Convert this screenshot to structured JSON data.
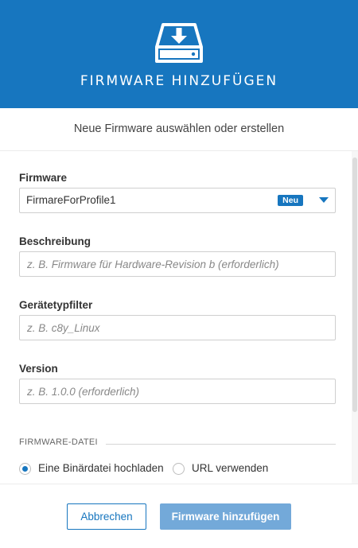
{
  "header": {
    "title": "FIRMWARE HINZUFÜGEN",
    "icon": "hard-drive-download-icon"
  },
  "subtitle": "Neue Firmware auswählen oder erstellen",
  "form": {
    "firmware": {
      "label": "Firmware",
      "value": "FirmareForProfile1",
      "badge": "Neu"
    },
    "description": {
      "label": "Beschreibung",
      "placeholder": "z. B. Firmware für Hardware-Revision b (erforderlich)"
    },
    "device_type_filter": {
      "label": "Gerätetypfilter",
      "placeholder": "z. B. c8y_Linux"
    },
    "version": {
      "label": "Version",
      "placeholder": "z. B. 1.0.0 (erforderlich)"
    },
    "firmware_file": {
      "section_title": "FIRMWARE-DATEI",
      "options": [
        {
          "label": "Eine Binärdatei hochladen",
          "checked": true
        },
        {
          "label": "URL verwenden",
          "checked": false
        }
      ]
    }
  },
  "footer": {
    "cancel_label": "Abbrechen",
    "submit_label": "Firmware hinzufügen"
  },
  "colors": {
    "primary": "#1776bf",
    "primary_disabled": "#73a9d9"
  }
}
